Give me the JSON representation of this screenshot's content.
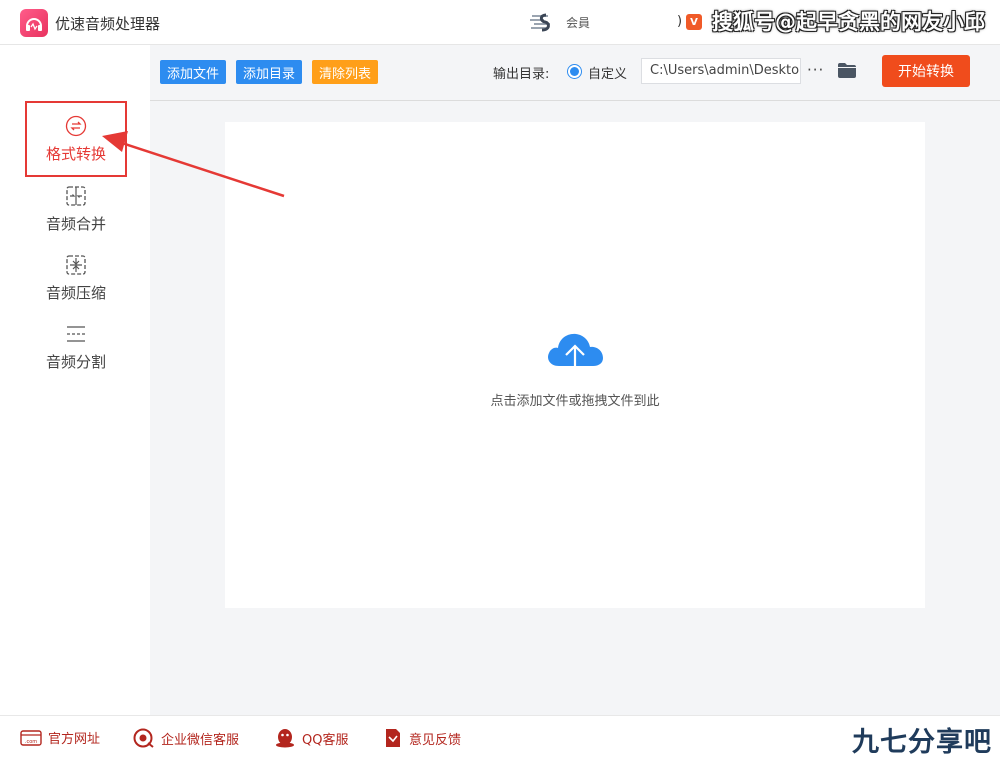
{
  "window": {
    "title": "优速音频处理器",
    "promo_text": "会員",
    "paren": ")",
    "vip_badge": "V"
  },
  "watermarks": {
    "top": "搜狐号@起早贪黑的网友小邱",
    "bottom": "九七分享吧"
  },
  "sidebar": {
    "items": [
      {
        "label": "格式转换",
        "icon": "format-convert-icon",
        "active": true
      },
      {
        "label": "音频合并",
        "icon": "audio-merge-icon",
        "active": false
      },
      {
        "label": "音频压缩",
        "icon": "audio-compress-icon",
        "active": false
      },
      {
        "label": "音频分割",
        "icon": "audio-split-icon",
        "active": false
      }
    ]
  },
  "toolbar": {
    "add_file": "添加文件",
    "add_folder": "添加目录",
    "clear_list": "清除列表",
    "output_label": "输出目录:",
    "radio_label": "自定义",
    "output_path": "C:\\Users\\admin\\Desktop",
    "more": "···",
    "start": "开始转换"
  },
  "dropzone": {
    "hint": "点击添加文件或拖拽文件到此"
  },
  "footer": {
    "items": [
      {
        "label": "官方网址",
        "icon": "website-icon"
      },
      {
        "label": "企业微信客服",
        "icon": "wechat-service-icon"
      },
      {
        "label": "QQ客服",
        "icon": "qq-icon"
      },
      {
        "label": "意见反馈",
        "icon": "feedback-icon"
      }
    ]
  },
  "colors": {
    "accent_blue": "#2d8cf0",
    "accent_orange": "#ff9f19",
    "start_red": "#f04c1c",
    "active_red": "#e53935"
  }
}
